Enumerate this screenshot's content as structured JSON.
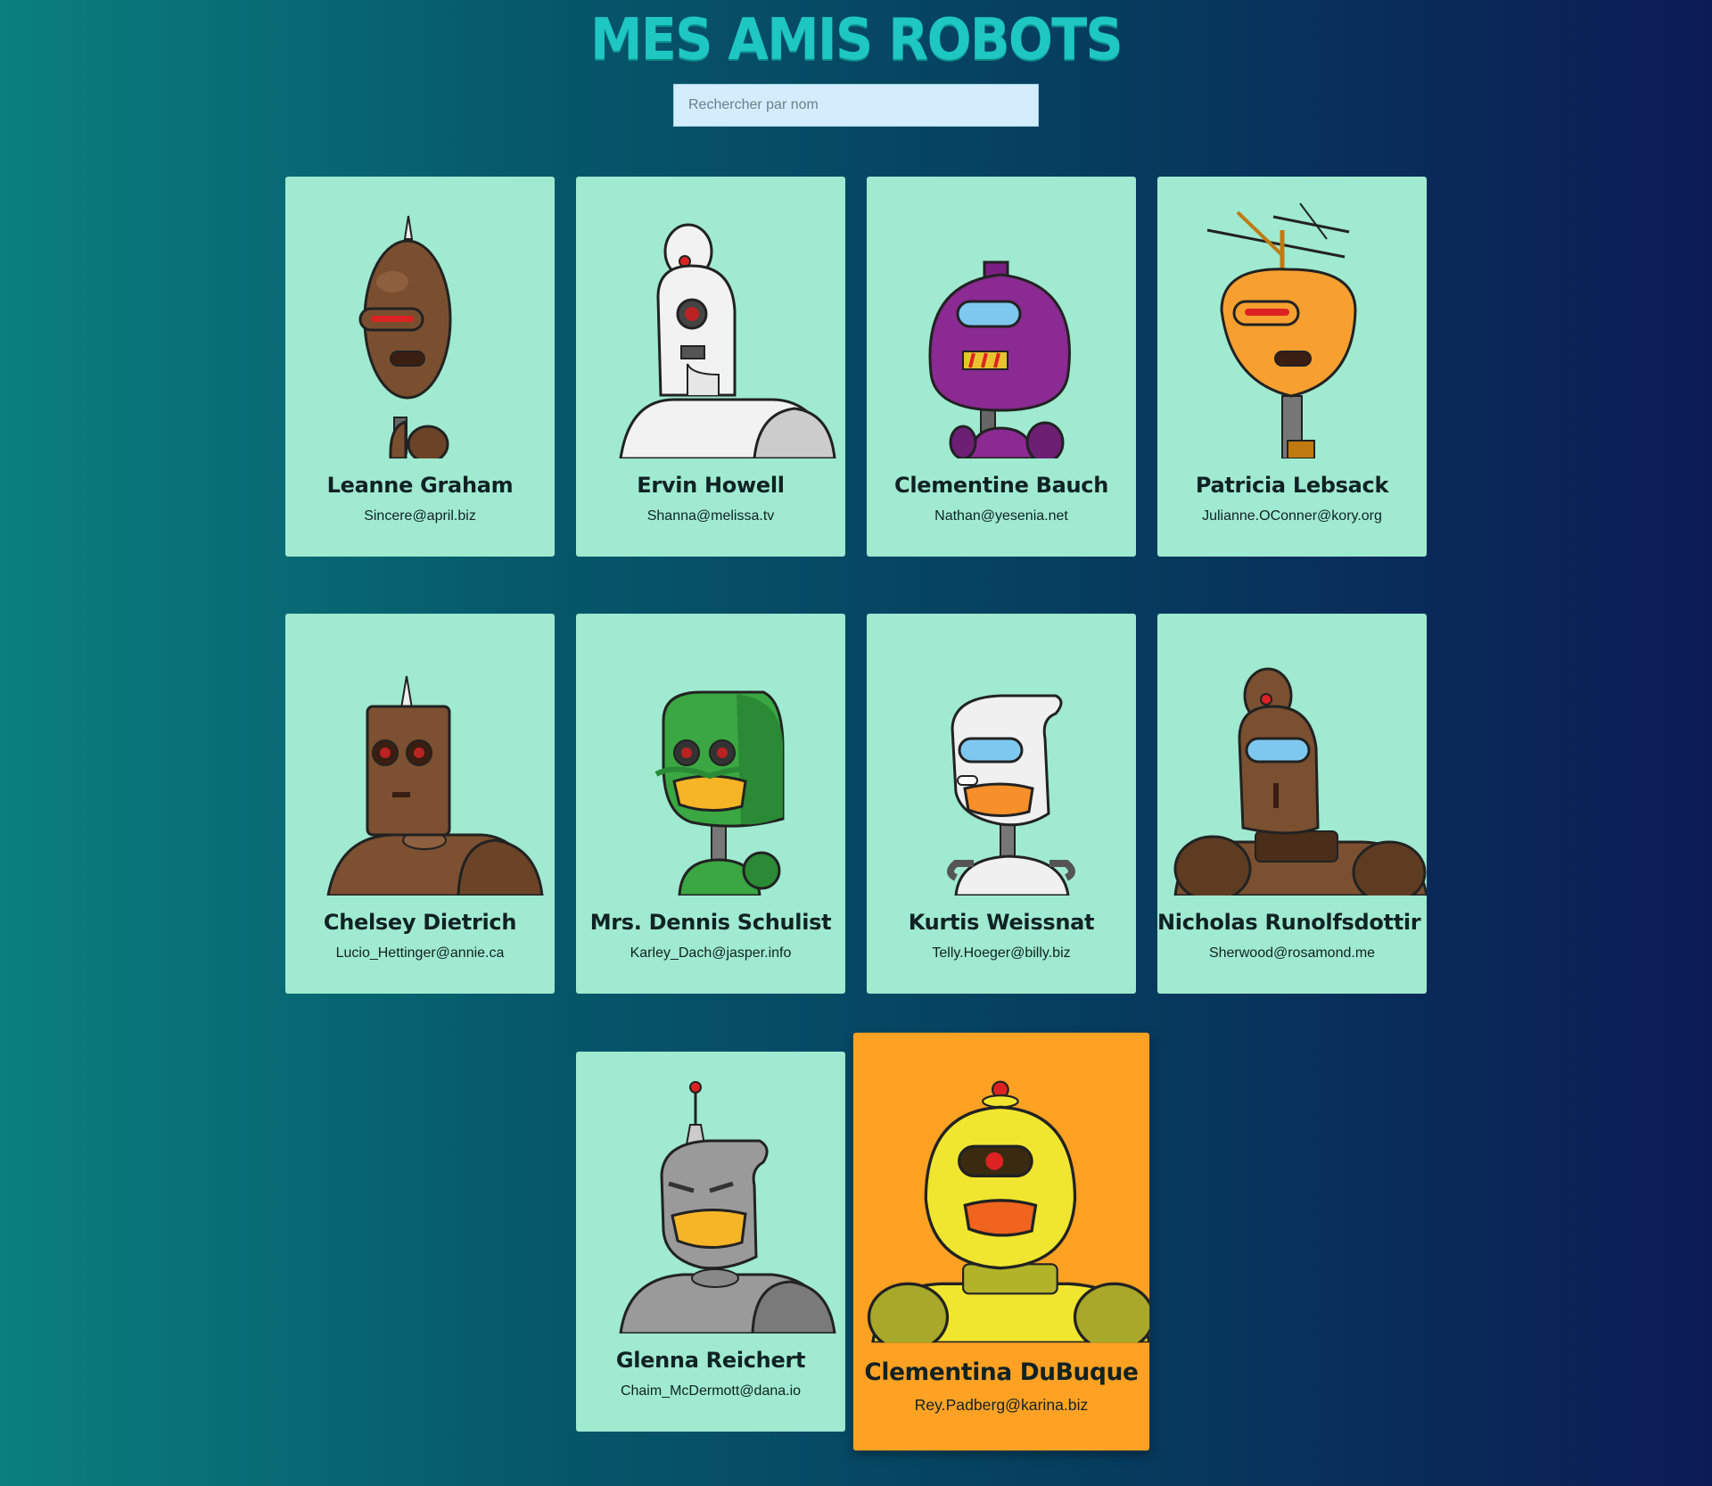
{
  "header": {
    "title": "Mes amis robots"
  },
  "search": {
    "placeholder": "Rechercher par nom",
    "value": ""
  },
  "robots": [
    {
      "name": "Leanne Graham",
      "email": "Sincere@april.biz",
      "color": "#7a4f30"
    },
    {
      "name": "Ervin Howell",
      "email": "Shanna@melissa.tv",
      "color": "#f2f2f2"
    },
    {
      "name": "Clementine Bauch",
      "email": "Nathan@yesenia.net",
      "color": "#8a2a92"
    },
    {
      "name": "Patricia Lebsack",
      "email": "Julianne.OConner@kory.org",
      "color": "#f7a030"
    },
    {
      "name": "Chelsey Dietrich",
      "email": "Lucio_Hettinger@annie.ca",
      "color": "#7c5030"
    },
    {
      "name": "Mrs. Dennis Schulist",
      "email": "Karley_Dach@jasper.info",
      "color": "#3aa742"
    },
    {
      "name": "Kurtis Weissnat",
      "email": "Telly.Hoeger@billy.biz",
      "color": "#f0f0f0"
    },
    {
      "name": "Nicholas Runolfsdottir V",
      "email": "Sherwood@rosamond.me",
      "color": "#7a5030"
    },
    {
      "name": "Glenna Reichert",
      "email": "Chaim_McDermott@dana.io",
      "color": "#9a9a9a"
    },
    {
      "name": "Clementina DuBuque",
      "email": "Rey.Padberg@karina.biz",
      "color": "#f0e630"
    }
  ],
  "active_card": "Clementina DuBuque",
  "colors": {
    "card_bg": "#9fead0",
    "active_card_bg": "#ffa224",
    "title": "#1ec7c2",
    "search_bg": "#d3edfd"
  }
}
